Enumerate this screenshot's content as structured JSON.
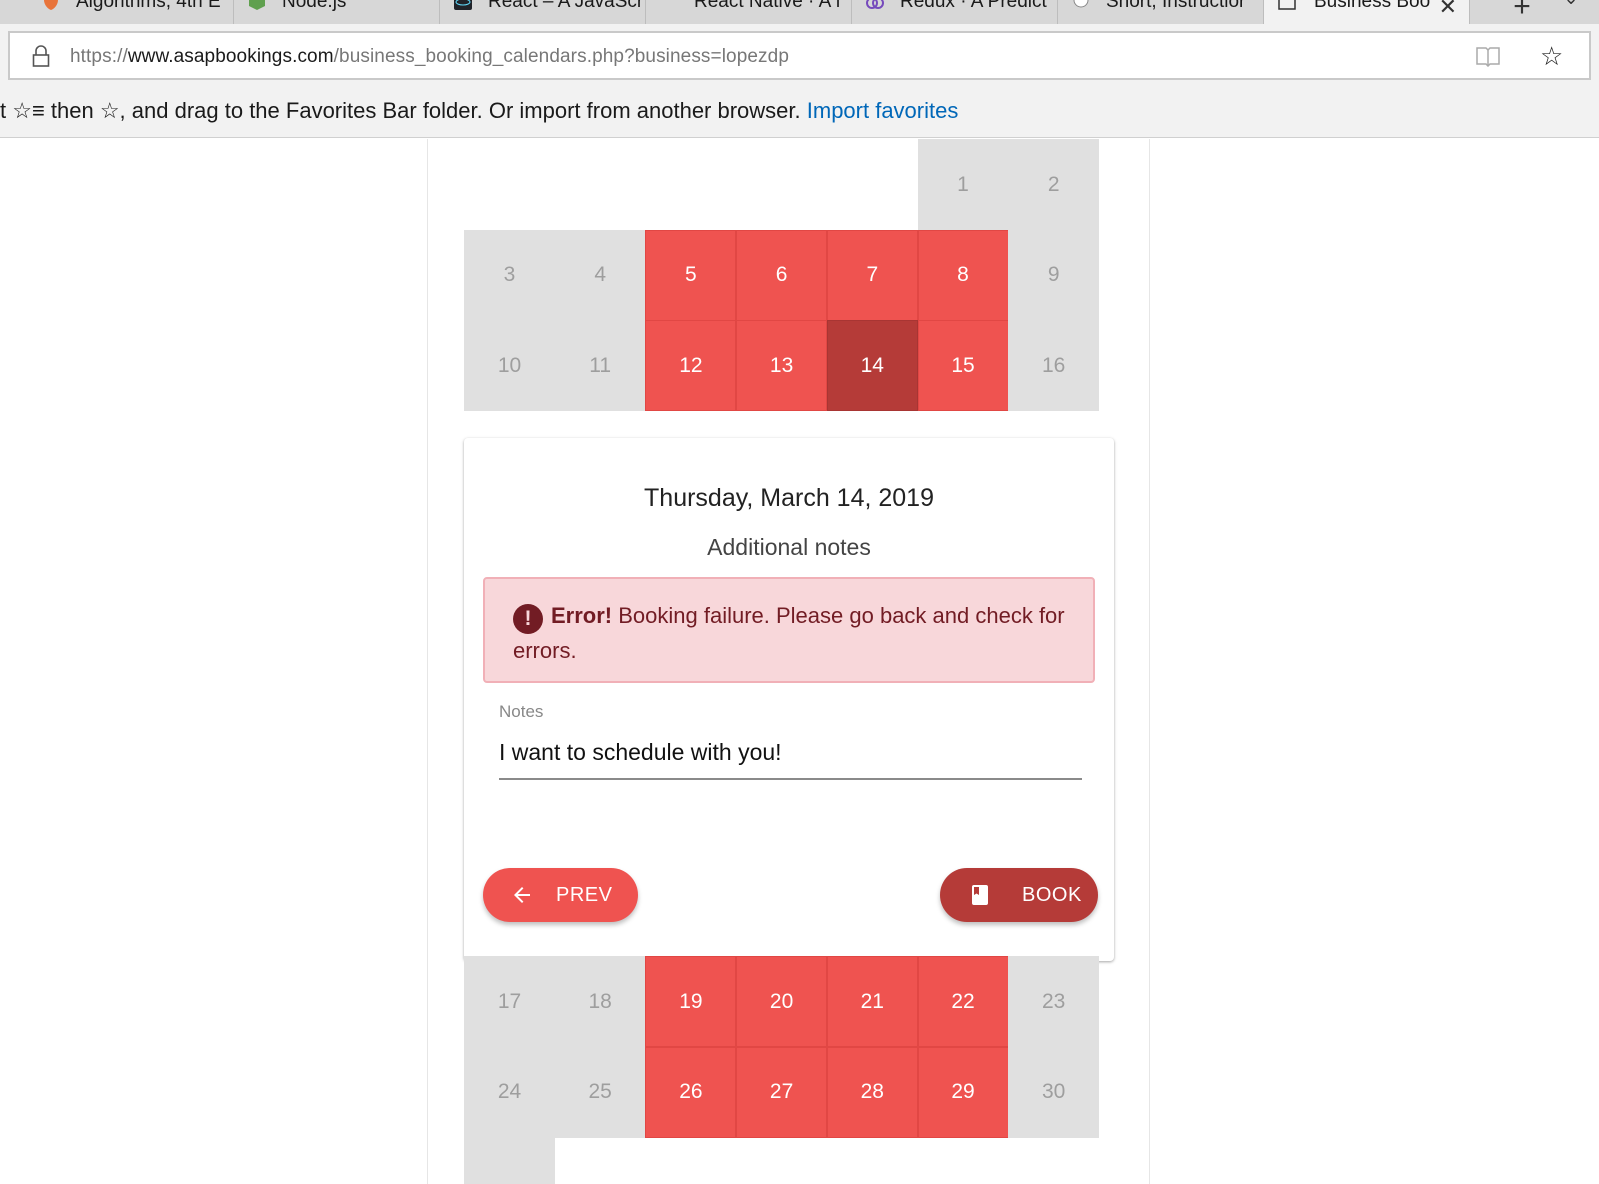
{
  "browser": {
    "tabs": [
      {
        "label": "Algorithms, 4th E",
        "icon": "princeton-shield-icon"
      },
      {
        "label": "Node.js",
        "icon": "nodejs-hexagon-icon"
      },
      {
        "label": "React – A JavaScr",
        "icon": "react-atom-icon"
      },
      {
        "label": "React Native · A f",
        "icon": "react-native-icon"
      },
      {
        "label": "Redux · A Predict",
        "icon": "redux-icon"
      },
      {
        "label": "Short, Instructior",
        "icon": "site-icon"
      },
      {
        "label": "Business Boo",
        "icon": "page-icon",
        "active": true
      }
    ],
    "close_glyph": "✕",
    "new_tab_glyph": "+",
    "tab_list_glyph": "⌄",
    "address": {
      "scheme": "https://",
      "domain": "www.asapbookings.com",
      "path": "/business_booking_calendars.php?business=lopezdp"
    },
    "favorite_glyph": "☆",
    "favbar": {
      "lead": "t  ☆≡  then ☆, and drag to the Favorites Bar folder. Or import from another browser. ",
      "link": "Import favorites"
    }
  },
  "calendar_top": {
    "rows": [
      [
        null,
        null,
        null,
        null,
        null,
        {
          "day": "1",
          "state": "off"
        },
        {
          "day": "2",
          "state": "off"
        }
      ],
      [
        {
          "day": "3",
          "state": "off"
        },
        {
          "day": "4",
          "state": "off"
        },
        {
          "day": "5",
          "state": "on"
        },
        {
          "day": "6",
          "state": "on"
        },
        {
          "day": "7",
          "state": "on"
        },
        {
          "day": "8",
          "state": "on"
        },
        {
          "day": "9",
          "state": "off"
        }
      ],
      [
        {
          "day": "10",
          "state": "off"
        },
        {
          "day": "11",
          "state": "off"
        },
        {
          "day": "12",
          "state": "on"
        },
        {
          "day": "13",
          "state": "on"
        },
        {
          "day": "14",
          "state": "sel"
        },
        {
          "day": "15",
          "state": "on"
        },
        {
          "day": "16",
          "state": "off"
        }
      ]
    ]
  },
  "booking": {
    "date": "Thursday, March 14, 2019",
    "subtitle": "Additional notes",
    "alert": {
      "icon_glyph": "!",
      "title": "Error!",
      "message": " Booking failure. Please go back and check for errors."
    },
    "notes_label": "Notes",
    "notes_value": "I want to schedule with you!",
    "prev_label": "PREV",
    "book_label": "BOOK"
  },
  "calendar_bottom": {
    "rows": [
      [
        {
          "day": "17",
          "state": "off"
        },
        {
          "day": "18",
          "state": "off"
        },
        {
          "day": "19",
          "state": "on"
        },
        {
          "day": "20",
          "state": "on"
        },
        {
          "day": "21",
          "state": "on"
        },
        {
          "day": "22",
          "state": "on"
        },
        {
          "day": "23",
          "state": "off"
        }
      ],
      [
        {
          "day": "24",
          "state": "off"
        },
        {
          "day": "25",
          "state": "off"
        },
        {
          "day": "26",
          "state": "on"
        },
        {
          "day": "27",
          "state": "on"
        },
        {
          "day": "28",
          "state": "on"
        },
        {
          "day": "29",
          "state": "on"
        },
        {
          "day": "30",
          "state": "off"
        }
      ],
      [
        {
          "day": "",
          "state": "off"
        },
        null,
        null,
        null,
        null,
        null,
        null
      ]
    ]
  },
  "colors": {
    "available": "#ef5350",
    "selected": "#b53b38",
    "unavailable": "#e0e0e0",
    "alert_bg": "#f8d7da",
    "alert_text": "#721c24",
    "link": "#0067b8"
  }
}
